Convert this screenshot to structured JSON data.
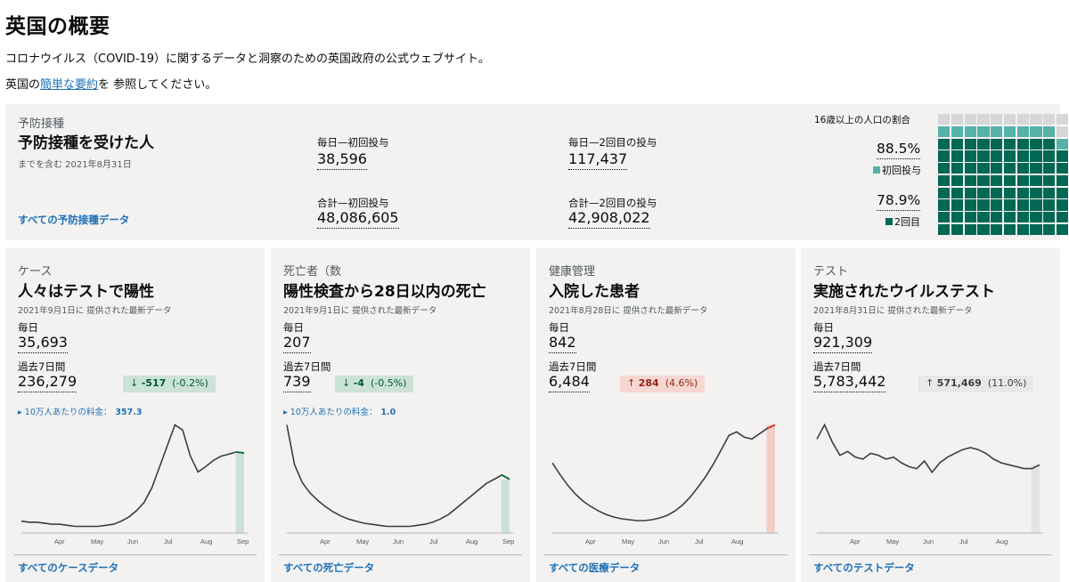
{
  "page": {
    "title": "英国の概要",
    "subtitle": "コロナウイルス（COVID-19）に関するデータと洞察のための英国政府の公式ウェブサイト。",
    "summary_prefix": "英国の",
    "summary_link": "簡単な要約",
    "summary_suffix": "を 参照してください。"
  },
  "vaccinations": {
    "caption": "予防接種",
    "heading": "予防接種を受けた人",
    "date_note": "までを含む 2021年8月31日",
    "link": "すべての予防接種データ",
    "daily_first_label": "毎日—初回投与",
    "daily_first_value": "38,596",
    "daily_second_label": "毎日—2回目の投与",
    "daily_second_value": "117,437",
    "total_first_label": "合計—初回投与",
    "total_first_value": "48,086,605",
    "total_second_label": "合計—2回目の投与",
    "total_second_value": "42,908,022",
    "population_label": "16歳以上の人口の割合",
    "first_pct": "88.5%",
    "first_legend": "初回投与",
    "second_pct": "78.9%",
    "second_legend": "2回目",
    "first_fraction": 0.885,
    "second_fraction": 0.789,
    "colors": {
      "first": "#54b3a6",
      "second": "#006853",
      "remaining": "#d6d7d8"
    }
  },
  "cards": [
    {
      "category": "ケース",
      "title": "人々はテストで陽性",
      "updated": "2021年9月1日に 提供された最新データ",
      "daily_label": "毎日",
      "daily_value": "35,693",
      "weekly_label": "過去7日間",
      "weekly_value": "236,279",
      "change_arrow": "↓",
      "change_value": "-517",
      "change_pct": "(-0.2%)",
      "rate_label": "▸ 10万人あたりの料金：",
      "rate_value": "357.3",
      "months": [
        "Apr",
        "May",
        "Jun",
        "Jul",
        "Aug",
        "Sep"
      ],
      "link": "すべてのケースデータ",
      "trend": "down",
      "series": [
        8,
        7,
        7,
        6,
        5,
        5,
        4,
        3,
        3,
        3,
        3,
        4,
        5,
        8,
        12,
        18,
        26,
        40,
        60,
        80,
        100,
        95,
        70,
        55,
        60,
        66,
        70,
        72,
        74,
        73
      ]
    },
    {
      "category": "死亡者（数",
      "title": "陽性検査から28日以内の死亡",
      "updated": "2021年9月1日に 提供された最新データ",
      "daily_label": "毎日",
      "daily_value": "207",
      "weekly_label": "過去7日間",
      "weekly_value": "739",
      "change_arrow": "↓",
      "change_value": "-4",
      "change_pct": "(-0.5%)",
      "rate_label": "▸ 10万人あたりの料金：",
      "rate_value": "1.0",
      "months": [
        "Apr",
        "May",
        "Jun",
        "Jul",
        "Aug",
        "Sep"
      ],
      "link": "すべての死亡データ",
      "trend": "down",
      "series": [
        100,
        62,
        45,
        35,
        28,
        22,
        17,
        13,
        10,
        8,
        6,
        5,
        4,
        3,
        3,
        3,
        3,
        4,
        5,
        7,
        10,
        14,
        20,
        26,
        32,
        38,
        44,
        48,
        52,
        48
      ]
    },
    {
      "category": "健康管理",
      "title": "入院した患者",
      "updated": "2021年8月28日に 提供された最新データ",
      "daily_label": "毎日",
      "daily_value": "842",
      "weekly_label": "過去7日間",
      "weekly_value": "6,484",
      "change_arrow": "↑",
      "change_value": "284",
      "change_pct": "(4.6%)",
      "rate_label": "",
      "rate_value": "",
      "months": [
        "Apr",
        "May",
        "Jun",
        "Jul",
        "Aug"
      ],
      "link": "すべての医療データ",
      "trend": "up",
      "series": [
        75,
        62,
        50,
        40,
        32,
        26,
        21,
        17,
        14,
        12,
        11,
        10,
        10,
        11,
        13,
        16,
        21,
        28,
        37,
        48,
        60,
        74,
        90,
        106,
        110,
        104,
        102,
        108,
        114,
        118
      ]
    },
    {
      "category": "テスト",
      "title": "実施されたウイルステスト",
      "updated": "2021年8月31日に 提供された最新データ",
      "daily_label": "毎日",
      "daily_value": "921,309",
      "weekly_label": "過去7日間",
      "weekly_value": "5,783,442",
      "change_arrow": "↑",
      "change_value": "571,469",
      "change_pct": "(11.0%)",
      "rate_label": "",
      "rate_value": "",
      "months": [
        "Apr",
        "May",
        "Jun",
        "Jul",
        "Aug"
      ],
      "link": "すべてのテストデータ",
      "trend": "neutral",
      "series": [
        95,
        110,
        92,
        78,
        82,
        76,
        74,
        80,
        78,
        74,
        76,
        70,
        66,
        64,
        72,
        60,
        70,
        76,
        80,
        84,
        86,
        84,
        80,
        74,
        70,
        68,
        66,
        64,
        64,
        68
      ]
    }
  ]
}
